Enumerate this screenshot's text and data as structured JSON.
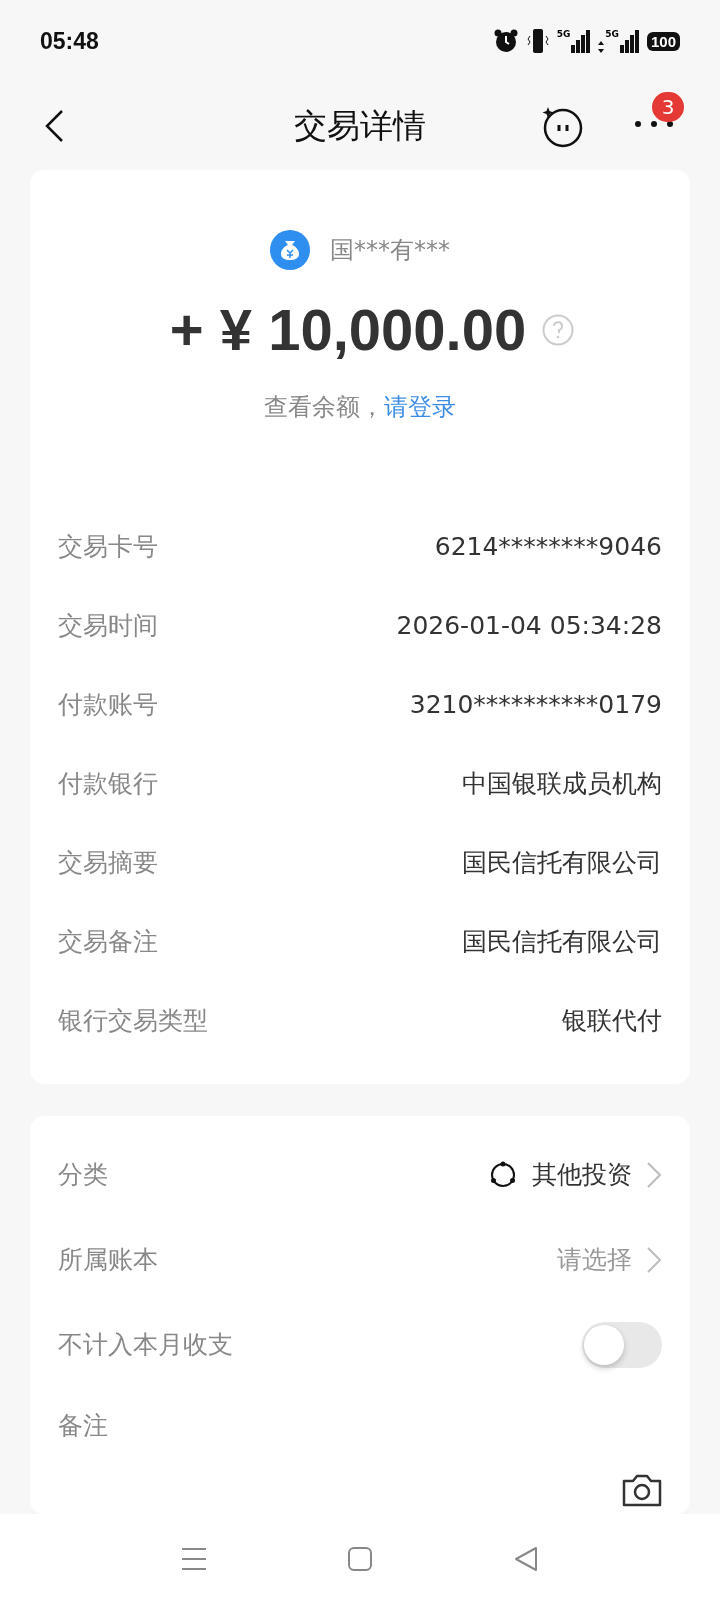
{
  "status_bar": {
    "time": "05:48",
    "signals": [
      {
        "label": "5G",
        "arrows": false
      },
      {
        "label": "5G",
        "arrows": true
      }
    ],
    "battery": "100"
  },
  "header": {
    "title": "交易详情",
    "badge": "3"
  },
  "summary": {
    "payer": "国***有***",
    "amount": "+ ¥ 10,000.00",
    "balance_prompt": "查看余额，",
    "login_link": "请登录"
  },
  "details": [
    {
      "label": "交易卡号",
      "value": "6214********9046"
    },
    {
      "label": "交易时间",
      "value": "2026-01-04 05:34:28"
    },
    {
      "label": "付款账号",
      "value": "3210**********0179"
    },
    {
      "label": "付款银行",
      "value": "中国银联成员机构"
    },
    {
      "label": "交易摘要",
      "value": "国民信托有限公司"
    },
    {
      "label": "交易备注",
      "value": "国民信托有限公司"
    },
    {
      "label": "银行交易类型",
      "value": "银联代付"
    }
  ],
  "settings": [
    {
      "kind": "category",
      "label": "分类",
      "value": "其他投资"
    },
    {
      "kind": "select",
      "label": "所属账本",
      "placeholder": "请选择"
    },
    {
      "kind": "toggle",
      "label": "不计入本月收支",
      "on": false
    },
    {
      "kind": "note",
      "label": "备注"
    }
  ]
}
